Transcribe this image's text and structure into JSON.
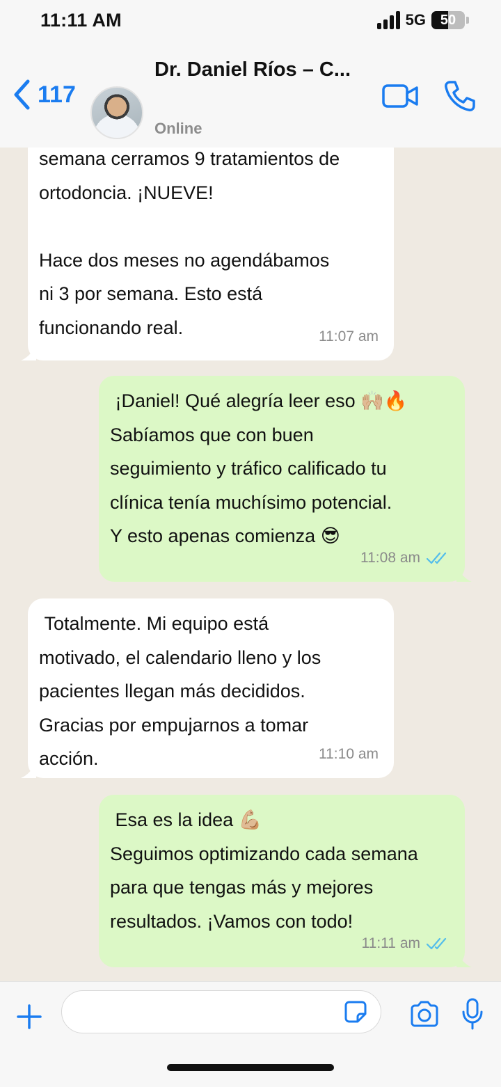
{
  "status_bar": {
    "time": "11:11 AM",
    "network": "5G",
    "battery_level": "50",
    "battery_fraction": 0.5
  },
  "header": {
    "back_count": "117",
    "contact_name": "Dr. Daniel Ríos – C...",
    "contact_status": "Online",
    "icons": [
      "chevron-left-icon",
      "video-call-icon",
      "phone-icon"
    ]
  },
  "messages": [
    {
      "direction": "in",
      "text": "semana cerramos 9 tratamientos de\nortodoncia. ¡NUEVE!\n\nHace dos meses no agendábamos\nni 3 por semana. Esto está\nfuncionando real.",
      "time": "11:07 am"
    },
    {
      "direction": "out",
      "text": " ¡Daniel! Qué alegría leer eso 🙌🏼🔥\nSabíamos que con buen\nseguimiento y tráfico calificado tu\nclínica tenía muchísimo potencial.\nY esto apenas comienza 😎",
      "time": "11:08 am",
      "read": true
    },
    {
      "direction": "in",
      "text": " Totalmente. Mi equipo está\nmotivado, el calendario lleno y los\npacientes llegan más decididos.\nGracias por empujarnos a tomar\nacción.",
      "time": "11:10 am"
    },
    {
      "direction": "out",
      "text": " Esa es la idea 💪🏼\nSeguimos optimizando cada semana\npara que tengas más y mejores\nresultados. ¡Vamos con todo!",
      "time": "11:11 am",
      "read": true
    }
  ],
  "composer": {
    "value": "",
    "icons": [
      "plus-icon",
      "sticker-icon",
      "camera-icon",
      "microphone-icon"
    ]
  },
  "colors": {
    "accent": "#1a7cf0",
    "incoming_bubble": "#ffffff",
    "outgoing_bubble": "#dcf8c6",
    "chat_background": "#efeae2",
    "read_ticks": "#53bdeb"
  }
}
